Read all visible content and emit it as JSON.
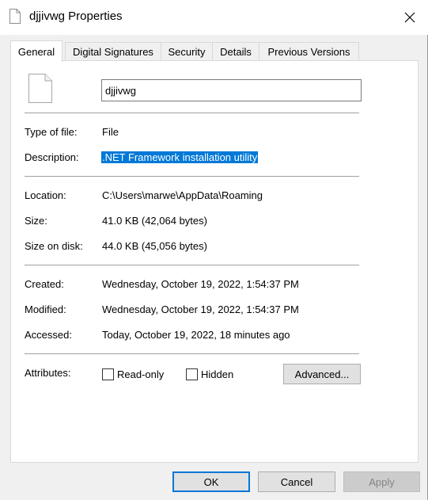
{
  "window": {
    "title": "djjivwg Properties",
    "title_icon": "file-icon",
    "close_icon": "close-icon"
  },
  "tabs": [
    {
      "label": "General",
      "active": true
    },
    {
      "label": "Digital Signatures",
      "active": false
    },
    {
      "label": "Security",
      "active": false
    },
    {
      "label": "Details",
      "active": false
    },
    {
      "label": "Previous Versions",
      "active": false
    }
  ],
  "general": {
    "file_name": "djjivwg",
    "file_icon": "file-icon",
    "type_label": "Type of file:",
    "type_value": "File",
    "description_label": "Description:",
    "description_value": ".NET Framework installation utility",
    "location_label": "Location:",
    "location_value": "C:\\Users\\marwe\\AppData\\Roaming",
    "size_label": "Size:",
    "size_value": "41.0 KB (42,064 bytes)",
    "size_on_disk_label": "Size on disk:",
    "size_on_disk_value": "44.0 KB (45,056 bytes)",
    "created_label": "Created:",
    "created_value": "Wednesday, October 19, 2022, 1:54:37 PM",
    "modified_label": "Modified:",
    "modified_value": "Wednesday, October 19, 2022, 1:54:37 PM",
    "accessed_label": "Accessed:",
    "accessed_value": "Today, October 19, 2022, 18 minutes ago",
    "attributes_label": "Attributes:",
    "readonly_label": "Read-only",
    "readonly_checked": false,
    "hidden_label": "Hidden",
    "hidden_checked": false,
    "advanced_label": "Advanced..."
  },
  "buttons": {
    "ok": "OK",
    "cancel": "Cancel",
    "apply": "Apply"
  },
  "colors": {
    "selection": "#0078d7",
    "dialog_bg": "#f0f0f0",
    "panel_bg": "#ffffff"
  }
}
